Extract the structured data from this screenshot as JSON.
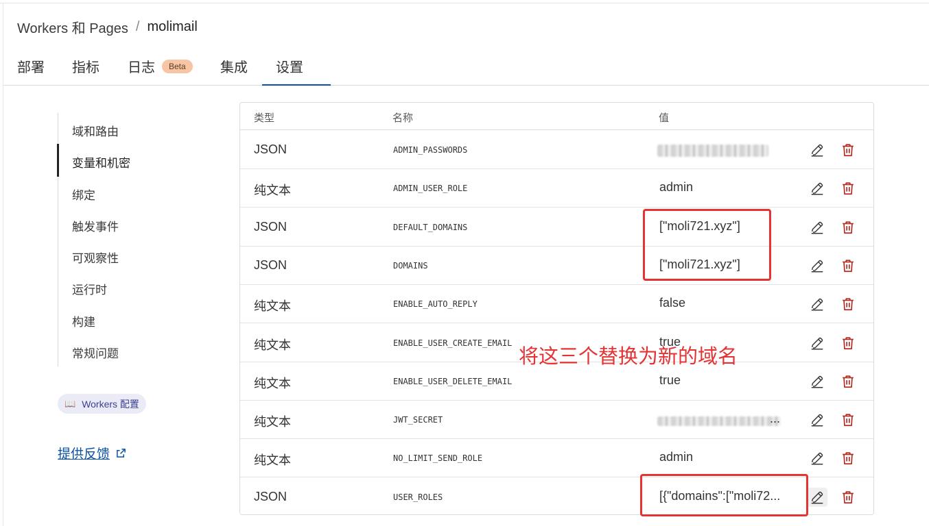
{
  "breadcrumb": {
    "parent": "Workers 和 Pages",
    "separator": "/",
    "current": "molimail"
  },
  "tabs": [
    {
      "label": "部署"
    },
    {
      "label": "指标"
    },
    {
      "label": "日志",
      "badge": "Beta"
    },
    {
      "label": "集成"
    },
    {
      "label": "设置",
      "active": true
    }
  ],
  "sidenav": {
    "items": [
      "域和路由",
      "变量和机密",
      "绑定",
      "触发事件",
      "可观察性",
      "运行时",
      "构建",
      "常规问题"
    ],
    "active": "变量和机密"
  },
  "config_pill": {
    "label": "Workers 配置",
    "icon": "book-icon"
  },
  "feedback": {
    "label": "提供反馈",
    "icon": "external-link-icon"
  },
  "table": {
    "headers": {
      "type": "类型",
      "name": "名称",
      "value": "值"
    },
    "rows": [
      {
        "type": "JSON",
        "name": "ADMIN_PASSWORDS",
        "value": "",
        "redacted": true
      },
      {
        "type": "纯文本",
        "name": "ADMIN_USER_ROLE",
        "value": "admin"
      },
      {
        "type": "JSON",
        "name": "DEFAULT_DOMAINS",
        "value": "[\"moli721.xyz\"]"
      },
      {
        "type": "JSON",
        "name": "DOMAINS",
        "value": "[\"moli721.xyz\"]"
      },
      {
        "type": "纯文本",
        "name": "ENABLE_AUTO_REPLY",
        "value": "false"
      },
      {
        "type": "纯文本",
        "name": "ENABLE_USER_CREATE_EMAIL",
        "value": "true"
      },
      {
        "type": "纯文本",
        "name": "ENABLE_USER_DELETE_EMAIL",
        "value": "true"
      },
      {
        "type": "纯文本",
        "name": "JWT_SECRET",
        "value": "...",
        "redacted": true
      },
      {
        "type": "纯文本",
        "name": "NO_LIMIT_SEND_ROLE",
        "value": "admin"
      },
      {
        "type": "JSON",
        "name": "USER_ROLES",
        "value": "[{\"domains\":[\"moli72..."
      }
    ],
    "row_actions": {
      "edit_icon": "pencil-icon",
      "delete_icon": "trash-icon"
    }
  },
  "annotation": {
    "text": "将这三个替换为新的域名",
    "color": "#e53232"
  },
  "colors": {
    "accent": "#0a51a5",
    "danger": "#b3261e",
    "highlight": "#e53232"
  }
}
